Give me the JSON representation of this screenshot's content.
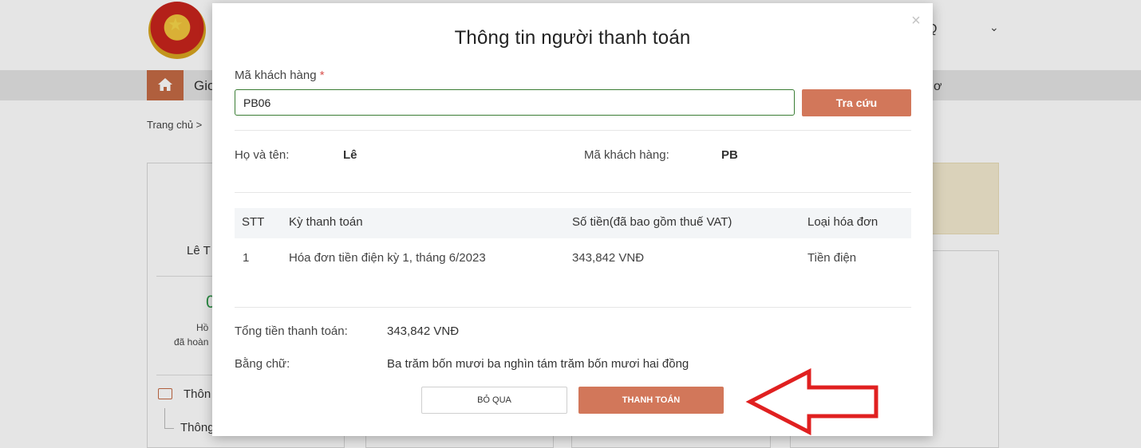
{
  "background": {
    "user_initial": "Q",
    "nav_text": "Gio",
    "nav_right_text": "ơ",
    "breadcrumb": "Trang chủ >",
    "name_fragment": "Lê T",
    "stat_value": "0",
    "stat_label_line1": "Hồ",
    "stat_label_line2": "đã hoàn",
    "info_section": "Thôn",
    "info_subitem": "Thông"
  },
  "modal": {
    "title": "Thông tin người thanh toán",
    "customer_code_label": "Mã khách hàng",
    "required_mark": "*",
    "customer_code_value": "PB06",
    "lookup_button": "Tra cứu",
    "info": {
      "name_label": "Họ và tên:",
      "name_value": "Lê",
      "code_label": "Mã khách hàng:",
      "code_value": "PB"
    },
    "table": {
      "headers": [
        "STT",
        "Kỳ thanh toán",
        "Số tiền(đã bao gồm thuế VAT)",
        "Loại hóa đơn"
      ],
      "rows": [
        [
          "1",
          "Hóa đơn tiền điện kỳ 1, tháng 6/2023",
          "343,842 VNĐ",
          "Tiền điện"
        ]
      ]
    },
    "summary": {
      "total_label": "Tổng tiền thanh toán:",
      "total_value": "343,842 VNĐ",
      "in_words_label": "Bằng chữ:",
      "in_words_value": "Ba trăm bốn mươi ba nghìn tám trăm bốn mươi hai đồng"
    },
    "buttons": {
      "skip": "BỎ QUA",
      "pay": "THANH TOÁN"
    },
    "close_glyph": "×"
  },
  "annotation": {
    "arrow_color": "#e02020",
    "arrow_icon": "left-arrow-outline"
  },
  "colors": {
    "accent": "#d2775a",
    "input_border": "#3a7d34"
  }
}
